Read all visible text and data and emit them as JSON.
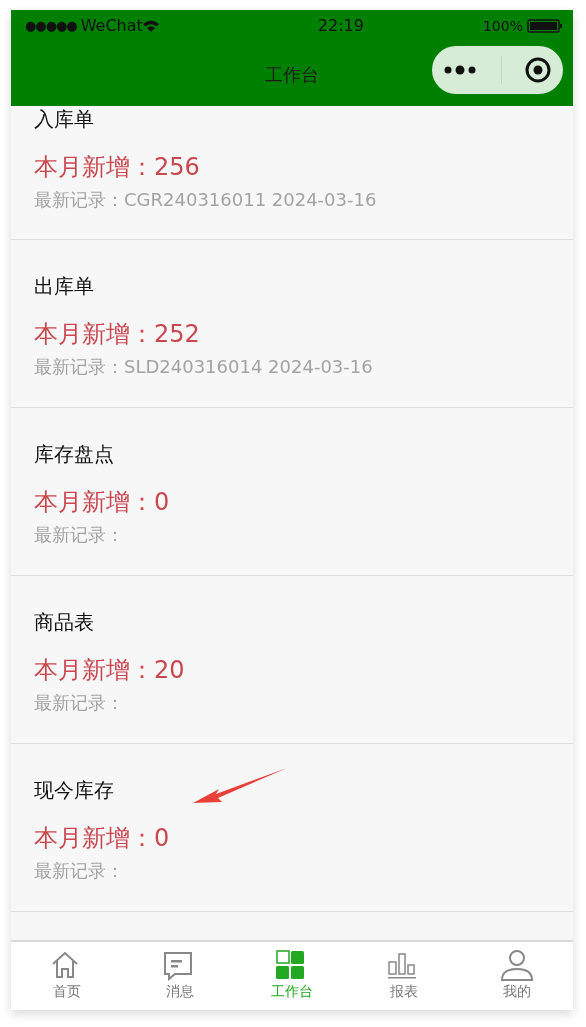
{
  "status_bar": {
    "signal": "●●●●●",
    "carrier": "WeChat",
    "time": "22:19",
    "battery": "100%"
  },
  "header": {
    "title": "工作台"
  },
  "cards": [
    {
      "title": "入库单",
      "count_line": "本月新增：256",
      "record_line": "最新记录：CGR240316011 2024-03-16"
    },
    {
      "title": "出库单",
      "count_line": "本月新增：252",
      "record_line": "最新记录：SLD240316014 2024-03-16"
    },
    {
      "title": "库存盘点",
      "count_line": "本月新增：0",
      "record_line": "最新记录："
    },
    {
      "title": "商品表",
      "count_line": "本月新增：20",
      "record_line": "最新记录："
    },
    {
      "title": "现今库存",
      "count_line": "本月新增：0",
      "record_line": "最新记录：",
      "annotated": true
    }
  ],
  "tab_bar": [
    {
      "label": "首页",
      "kind": "home",
      "selected": false
    },
    {
      "label": "消息",
      "kind": "message",
      "selected": false
    },
    {
      "label": "工作台",
      "kind": "grid",
      "selected": true
    },
    {
      "label": "报表",
      "kind": "chart",
      "selected": false
    },
    {
      "label": "我的",
      "kind": "user",
      "selected": false
    }
  ]
}
